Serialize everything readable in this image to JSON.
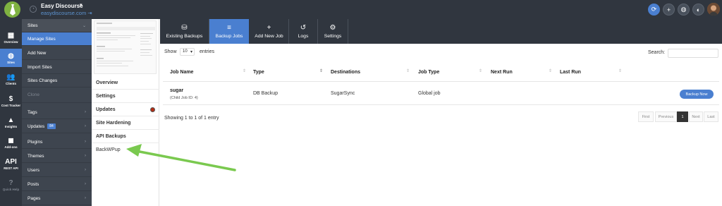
{
  "header": {
    "site_title": "Easy Discourse",
    "site_url": "easydiscourse.com",
    "caret": "▾",
    "avatar_color": "#8b5a3c"
  },
  "rail": [
    {
      "icon": "grid-icon",
      "glyph": "▦",
      "label": "Overview"
    },
    {
      "icon": "globe-icon",
      "glyph": "◍",
      "label": "Sites"
    },
    {
      "icon": "clients-icon",
      "glyph": "👥",
      "label": "Clients"
    },
    {
      "icon": "dollar-icon",
      "glyph": "$",
      "label": "Cost Tracker"
    },
    {
      "icon": "insights-icon",
      "glyph": "▲",
      "label": "Insights"
    },
    {
      "icon": "add-ons-icon",
      "glyph": "◼",
      "label": "Add-ons"
    },
    {
      "icon": "api-icon",
      "glyph": "API",
      "label": "REST API"
    },
    {
      "icon": "help-icon",
      "glyph": "?",
      "label": "Quick Help"
    }
  ],
  "submenu": {
    "head": "Sites",
    "items": [
      "Manage Sites",
      "Add New",
      "Import Sites",
      "Sites Changes",
      "Clone"
    ],
    "groups": [
      "Tags",
      "Updates",
      "Plugins",
      "Themes",
      "Users",
      "Posts",
      "Pages"
    ],
    "updates_badge": "84"
  },
  "preview": {
    "items": [
      "Overview",
      "Settings",
      "Updates",
      "Site Hardening",
      "API Backups",
      "BackWPup"
    ]
  },
  "tabs": [
    {
      "icon": "backups-icon",
      "glyph": "⛁",
      "label": "Existing Backups"
    },
    {
      "icon": "backup-jobs-icon",
      "glyph": "≡",
      "label": "Backup Jobs"
    },
    {
      "icon": "plus-icon",
      "glyph": "+",
      "label": "Add New Job"
    },
    {
      "icon": "history-icon",
      "glyph": "↺",
      "label": "Logs"
    },
    {
      "icon": "gear-icon",
      "glyph": "⚙",
      "label": "Settings"
    }
  ],
  "table": {
    "show_label": "Show",
    "page_size": "10",
    "entries_label": "entries",
    "search_label": "Search:",
    "columns": [
      "Job Name",
      "Type",
      "Destinations",
      "Job Type",
      "Next Run",
      "Last Run"
    ],
    "rows": [
      {
        "job_name": "sugar",
        "job_sub": "(Child Job ID: 4)",
        "type": "DB Backup",
        "destinations": "SugarSync",
        "job_type": "Global job",
        "next_run": "",
        "last_run": "",
        "action": "Backup Now"
      }
    ],
    "summary": "Showing 1 to 1 of 1 entry",
    "pagination": [
      "First",
      "Previous",
      "1",
      "Next",
      "Last"
    ]
  },
  "colors": {
    "accent": "#4a7fd0",
    "dark_bg": "#30363f",
    "arrow": "#7ac94f",
    "logo": "#7fb241"
  }
}
